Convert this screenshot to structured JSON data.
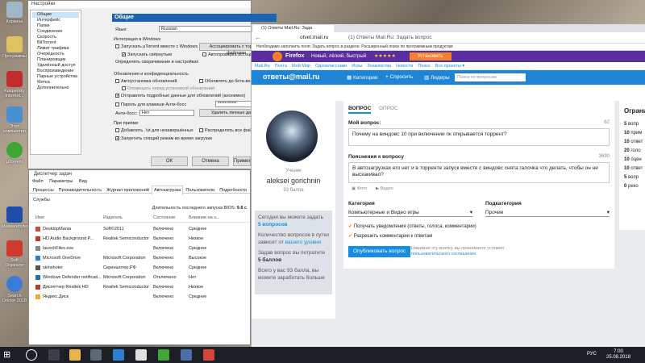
{
  "desktop": {
    "icons": [
      "Корзина",
      "Программы",
      "Kaspersky Internet...",
      "Этот компьютер",
      "µTorrent",
      "Malwarebytes",
      "Soft Organizer",
      "Search Doctor 2018"
    ]
  },
  "settings": {
    "title": "Настройки",
    "tree": [
      "Общие",
      "Интерфейс",
      "Папки",
      "Соединение",
      "Скорость",
      "BitTorrent",
      "Лимит трафика",
      "Очерёдность",
      "Планировщик",
      "Удалённый доступ",
      "Воспроизведение",
      "Парные устройства",
      "Метка",
      "Дополнительно"
    ],
    "panel_title": "Общие",
    "language_label": "Язык:",
    "language_value": "Russian",
    "integration_label": "Интеграция в Windows",
    "start_with_windows": "Запускать µTorrent вместе с Windows",
    "start_minimized": "Запускать свёрнутым",
    "default_reaction": "Определить сворачивание в настройках",
    "assoc_button": "Ассоциировать с торрент-файлами",
    "auto_assoc": "Автопроверка ассоциаций",
    "updates_label": "Обновления и конфиденциальность",
    "auto_update": "Автоустановка обновлений",
    "beta_update": "Обновлять до бета-версий",
    "send_info": "Отправлять подробные данные для обновлений (анонимно)",
    "notify_update": "Оповещать перед установкой обновлений",
    "password_label": "Пароль для клавиши Анти-босс",
    "password_value": "***********",
    "antiboss_label": "Анти-босс:",
    "antiboss_value": "Нет",
    "hide_button": "Удалить личные данные",
    "on_add_label": "При приёме",
    "add_incomplete": "Добавлять .!ut для незавершённых",
    "allocate": "Распределять все файлы",
    "prevent_sleep": "Запретить спящий режим во время загрузки",
    "ok": "ОК",
    "cancel": "Отмена",
    "apply": "Применить"
  },
  "taskmgr": {
    "title": "Диспетчер задач",
    "menu": [
      "Файл",
      "Параметры",
      "Вид"
    ],
    "tabs": [
      "Процессы",
      "Производительность",
      "Журнал приложений",
      "Автозагрузка",
      "Пользователи",
      "Подробности",
      "Службы"
    ],
    "active_tab": "Автозагрузка",
    "bios_label": "Длительность последнего запуска BIOS:",
    "bios_value": "9.8 с",
    "columns": [
      "Имя",
      "Издатель",
      "Состояние",
      "Влияние на з..."
    ],
    "rows": [
      {
        "name": "DesktopMania",
        "publisher": "Soft©2011",
        "state": "Включено",
        "impact": "Среднее",
        "color": "#d04a3a"
      },
      {
        "name": "HD Audio Background P...",
        "publisher": "Realtek Semiconductor",
        "state": "Включено",
        "impact": "Низкое",
        "color": "#c0392b"
      },
      {
        "name": "launchFiles.exe",
        "publisher": "",
        "state": "Включено",
        "impact": "Среднее",
        "color": "#7f8c8d"
      },
      {
        "name": "Microsoft OneDrive",
        "publisher": "Microsoft Corporation",
        "state": "Включено",
        "impact": "Высокое",
        "color": "#2a7fd4"
      },
      {
        "name": "skinshoter",
        "publisher": "Скриншотер.РФ",
        "state": "Включено",
        "impact": "Среднее",
        "color": "#555555"
      },
      {
        "name": "Windows Defender notificati...",
        "publisher": "Microsoft Corporation",
        "state": "Отключено",
        "impact": "Нет",
        "color": "#1f6fb5"
      },
      {
        "name": "Диспетчер Realtek HD",
        "publisher": "Realtek Semiconductor",
        "state": "Включено",
        "impact": "Низкое",
        "color": "#c0392b"
      },
      {
        "name": "Яндекс.Диск",
        "publisher": "",
        "state": "Включено",
        "impact": "Среднее",
        "color": "#f5a623"
      }
    ]
  },
  "browser": {
    "tabs": [
      "(1) Ответы Mail.Ru: Зада",
      "(1) Ответы Mail.Ru: Задать вопрос"
    ],
    "url": "otvet.mail.ru",
    "page_title": "(1) Ответы Mail.Ru: Задать вопрос",
    "bookmark_text": "Необходимо заполнить поля: Задать вопрос в разделе: Расширенный поиск по программным продуктам",
    "banner": {
      "brand": "Firefox",
      "slogan": "Новый, лёгкий, быстрый",
      "stars": "★★★★★",
      "install": "Установить"
    },
    "mailnav": [
      "Mail.Ru",
      "Почта",
      "Мой Мир",
      "Одноклассники",
      "Игры",
      "Знакомства",
      "Новости",
      "Поиск",
      "Все проекты ▾"
    ],
    "otvet_logo": "ответы@mail.ru",
    "categories_btn": "Категории",
    "ask_btn": "+ Спросить",
    "leaders_btn": "Лидеры",
    "search_placeholder": "Поиск по вопросам",
    "profile": {
      "role": "Ученик",
      "name": "aleksei gorichnin",
      "points": "93 балла"
    },
    "left_panel": {
      "today": "Сегодня вы можете задать",
      "today_value": "5 вопросов",
      "count_text": "Количество вопросов в сутки зависит от",
      "count_link": "вашего уровня",
      "cost_text": "Задав вопрос вы потратите",
      "cost_value": "5 баллов",
      "total_text": "Всего у вас 93 балла, вы можете заработать больше"
    },
    "form": {
      "tab_question": "ВОПРОС",
      "tab_poll": "ОПРОС",
      "my_question_label": "Мой вопрос:",
      "my_question_count": "62",
      "my_question_value": "Почему на виндовс 10 при включении пк открывается торрент?",
      "explanation_label": "Пояснения к вопросу",
      "explanation_count": "3690",
      "explanation_value": "В автозагрузках его нет и в торренте запуск вместе с виндовс снята галочка что делать, чтобы он не выскакивал?",
      "photo": "Фото",
      "video": "Видео",
      "category_label": "Категория",
      "category_value": "Компьютерные и Видео игры",
      "subcategory_label": "Подкатегория",
      "subcategory_value": "Прочие",
      "notify": "Получать уведомления (ответы, голоса, комментарии)",
      "allow_comments": "Разрешить комментарии к ответам",
      "publish": "Опубликовать вопрос",
      "terms_text": "Нажимая эту кнопку, вы принимаете условия",
      "terms_link": "пользовательского соглашения"
    },
    "right_panel": {
      "title": "Ограни",
      "items": [
        {
          "num": "5",
          "text": "вопр"
        },
        {
          "num": "10",
          "text": "прим"
        },
        {
          "num": "10",
          "text": "ответ"
        },
        {
          "num": "20",
          "text": "голо"
        },
        {
          "num": "10",
          "text": "оцен"
        },
        {
          "num": "10",
          "text": "ответ"
        },
        {
          "num": "5",
          "text": "вопр"
        },
        {
          "num": "0",
          "text": "реко"
        }
      ]
    }
  },
  "taskbar": {
    "time": "7:00",
    "date": "25.08.2018",
    "lang": "РУС"
  }
}
